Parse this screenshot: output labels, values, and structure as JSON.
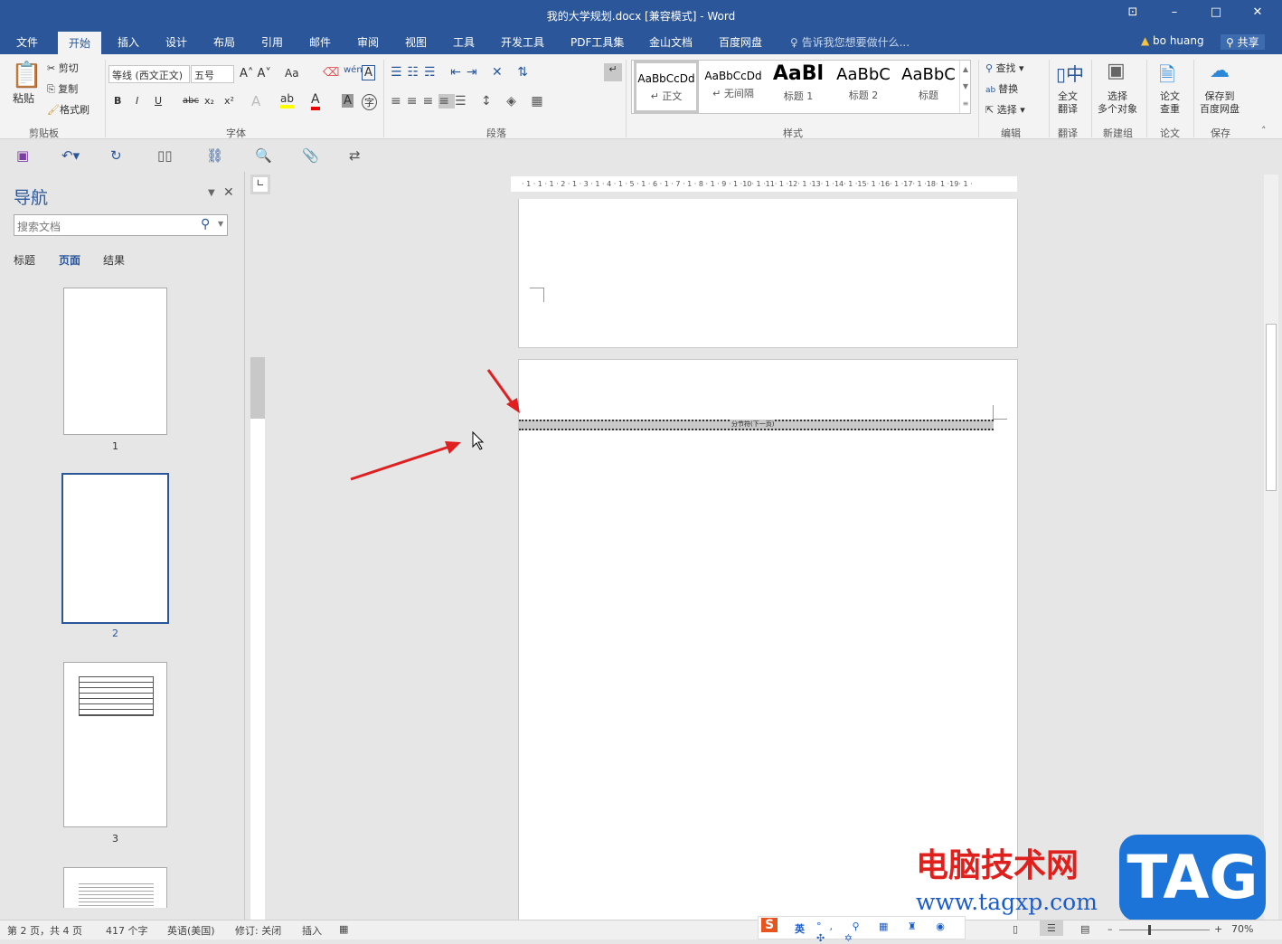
{
  "window": {
    "title": "我的大学规划.docx [兼容模式] - Word",
    "user": "bo huang",
    "share": "共享",
    "tell_me": "告诉我您想要做什么..."
  },
  "tabs": [
    "文件",
    "开始",
    "插入",
    "设计",
    "布局",
    "引用",
    "邮件",
    "审阅",
    "视图",
    "工具",
    "开发工具",
    "PDF工具集",
    "金山文档",
    "百度网盘"
  ],
  "ribbon": {
    "clipboard": {
      "paste": "粘贴",
      "cut": "剪切",
      "copy": "复制",
      "format_painter": "格式刷",
      "group": "剪贴板"
    },
    "font": {
      "name": "等线 (西文正文)",
      "size": "五号",
      "group": "字体",
      "case": "Aa",
      "bold": "B",
      "italic": "I",
      "underline": "U",
      "strike": "abc",
      "sub": "x₂",
      "sup": "x²"
    },
    "paragraph": {
      "group": "段落"
    },
    "styles": {
      "group": "样式",
      "items": [
        {
          "sample": "AaBbCcDd",
          "label": "↵ 正文"
        },
        {
          "sample": "AaBbCcDd",
          "label": "↵ 无间隔"
        },
        {
          "sample": "AaBl",
          "label": "标题 1"
        },
        {
          "sample": "AaBbC",
          "label": "标题 2"
        },
        {
          "sample": "AaBbC",
          "label": "标题"
        }
      ]
    },
    "editing": {
      "find": "查找",
      "replace": "替换",
      "select": "选择",
      "group": "编辑"
    },
    "translate": {
      "label1": "全文",
      "label2": "翻译",
      "group": "翻译"
    },
    "newgroup": {
      "label1": "选择",
      "label2": "多个对象",
      "group": "新建组"
    },
    "paper": {
      "label1": "论文",
      "label2": "查重",
      "group": "论文"
    },
    "save": {
      "label1": "保存到",
      "label2": "百度网盘",
      "group": "保存"
    }
  },
  "nav": {
    "title": "导航",
    "search_placeholder": "搜索文档",
    "tabs": [
      "标题",
      "页面",
      "结果"
    ],
    "active_tab": "页面",
    "pages": [
      "1",
      "2",
      "3"
    ]
  },
  "document": {
    "section_break": "分节符(下一页)",
    "ruler_h": "· 1 · 1 · 1 · 2 · 1 · 3 · 1 · 4 · 1 · 5 · 1 · 6 · 1 · 7 · 1 · 8 · 1 · 9 · 1 ·10· 1 ·11· 1 ·12· 1 ·13· 1 ·14· 1 ·15· 1 ·16· 1 ·17· 1 ·18· 1 ·19· 1 ·"
  },
  "status": {
    "page": "第 2 页，共 4 页",
    "words": "417 个字",
    "language": "英语(美国)",
    "track": "修订: 关闭",
    "mode": "插入",
    "zoom": "70%",
    "ime": "英"
  },
  "watermark": {
    "cn": "电脑技术网",
    "url": "www.tagxp.com",
    "logo": "TAG"
  },
  "colors": {
    "brand": "#2b579a",
    "arrow": "#e02020"
  }
}
